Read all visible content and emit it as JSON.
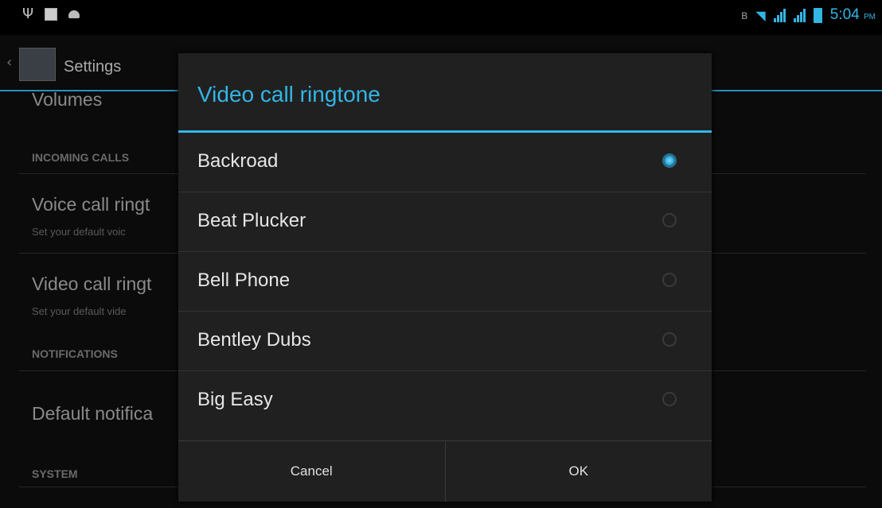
{
  "status_bar": {
    "time": "5:04",
    "ampm": "PM",
    "icons_left": [
      "usb-icon",
      "image-icon",
      "android-debug-icon"
    ],
    "icons_right": [
      "bluetooth-icon",
      "wifi-icon",
      "signal-icon",
      "signal-icon",
      "battery-icon"
    ]
  },
  "settings": {
    "title": "Settings",
    "rows": {
      "volumes": "Volumes",
      "incoming_calls_header": "INCOMING CALLS",
      "voice_call_title": "Voice call ringt",
      "voice_call_summary": "Set your default voic",
      "video_call_title": "Video call ringt",
      "video_call_summary": "Set your default vide",
      "notifications_header": "NOTIFICATIONS",
      "default_notification": "Default notifica",
      "system_header": "SYSTEM"
    }
  },
  "dialog": {
    "title": "Video call ringtone",
    "options": [
      {
        "label": "Backroad",
        "selected": true
      },
      {
        "label": "Beat Plucker",
        "selected": false
      },
      {
        "label": "Bell Phone",
        "selected": false
      },
      {
        "label": "Bentley Dubs",
        "selected": false
      },
      {
        "label": "Big Easy",
        "selected": false
      }
    ],
    "cancel_label": "Cancel",
    "ok_label": "OK"
  },
  "colors": {
    "accent": "#33b5e5",
    "dialog_bg": "#202020",
    "screen_bg": "#0b0b0b"
  }
}
